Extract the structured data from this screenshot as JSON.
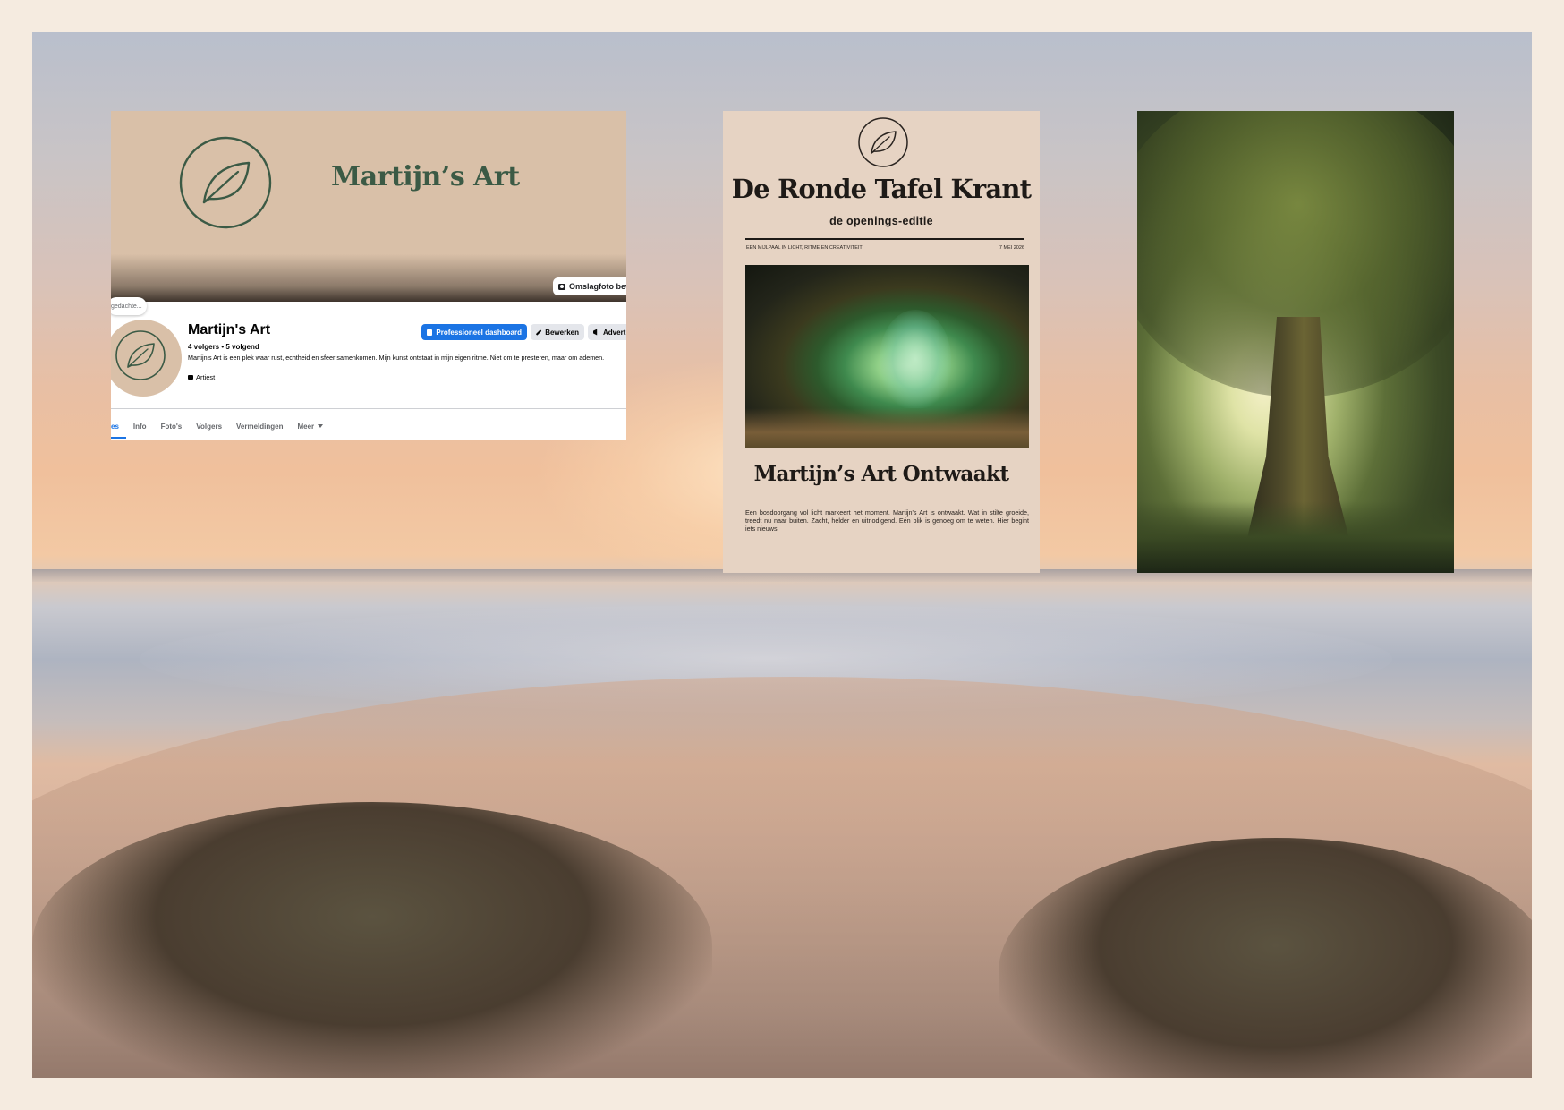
{
  "facebook": {
    "cover_title": "Martijn’s Art",
    "cover_button": "Omslagfoto bewe",
    "bubble": "gedachte...",
    "name": "Martijn's Art",
    "stats": "4 volgers • 5 volgend",
    "bio": "Martijn's Art is een plek waar rust, echtheid en sfeer samenkomen. Mijn kunst ontstaat in mijn eigen ritme. Niet om te presteren, maar om ademen.",
    "category": "Artiest",
    "buttons": {
      "dashboard": "Professioneel dashboard",
      "edit": "Bewerken",
      "advertise": "Advert"
    },
    "tabs": [
      "es",
      "Info",
      "Foto's",
      "Volgers",
      "Vermeldingen",
      "Meer"
    ]
  },
  "newspaper": {
    "title": "De Ronde Tafel Krant",
    "subtitle": "de openings-editie",
    "meta_left": "EEN MIJLPAAL IN LICHT, RITME EN CREATIVITEIT",
    "meta_right": "7 MEI 2026",
    "headline": "Martijn’s Art Ontwaakt",
    "body": "Een bosdoorgang vol licht markeert het moment. Martijn's Art is ontwaakt. Wat in stilte groeide, treedt nu naar buiten. Zacht, helder en uitnodigend. Eén blik is genoeg om te weten. Hier begint iets nieuws."
  },
  "colors": {
    "page_border": "#f5ebe0",
    "cover_beige": "#d9c0a8",
    "logo_green": "#3b5a45",
    "fb_blue": "#1b74e4",
    "paper_bg": "#e6d3c3"
  },
  "icons": {
    "leaf_logo": "leaf-circle-icon",
    "camera": "camera-icon",
    "dashboard": "dashboard-icon",
    "pencil": "pencil-icon",
    "megaphone": "megaphone-icon",
    "category": "briefcase-icon",
    "caret": "caret-down-icon"
  }
}
